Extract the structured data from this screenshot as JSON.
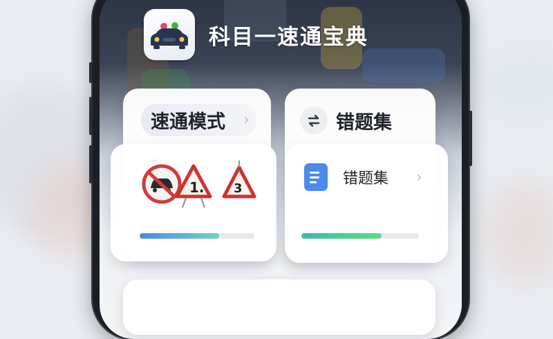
{
  "app": {
    "title": "科目一速通宝典",
    "icon": "car-icon"
  },
  "cards": {
    "fast_mode": {
      "title": "速通模式",
      "icons": [
        "no-overtaking-sign-icon",
        "warning-sign-1-icon",
        "warning-sign-3-icon"
      ],
      "progress": 0.69,
      "progress_colors": [
        "#4a8bec",
        "#6cd3c6"
      ]
    },
    "wrong_set": {
      "header_title": "错题集",
      "item_label": "错题集",
      "progress": 0.68,
      "progress_colors": [
        "#3cbab0",
        "#5fdb7a"
      ]
    }
  }
}
